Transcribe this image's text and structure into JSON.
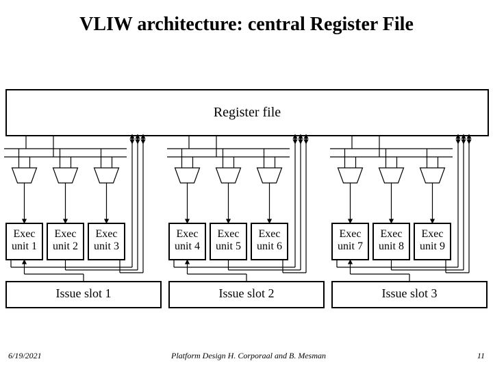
{
  "title": "VLIW architecture: central Register File",
  "register_file_label": "Register file",
  "units": [
    {
      "line1": "Exec",
      "line2": "unit 1"
    },
    {
      "line1": "Exec",
      "line2": "unit 2"
    },
    {
      "line1": "Exec",
      "line2": "unit 3"
    },
    {
      "line1": "Exec",
      "line2": "unit 4"
    },
    {
      "line1": "Exec",
      "line2": "unit 5"
    },
    {
      "line1": "Exec",
      "line2": "unit 6"
    },
    {
      "line1": "Exec",
      "line2": "unit 7"
    },
    {
      "line1": "Exec",
      "line2": "unit 8"
    },
    {
      "line1": "Exec",
      "line2": "unit 9"
    }
  ],
  "issue_slots": [
    "Issue slot 1",
    "Issue slot 2",
    "Issue slot 3"
  ],
  "footer": {
    "date": "6/19/2021",
    "mid": "Platform Design      H. Corporaal and B. Mesman",
    "page": "11"
  }
}
